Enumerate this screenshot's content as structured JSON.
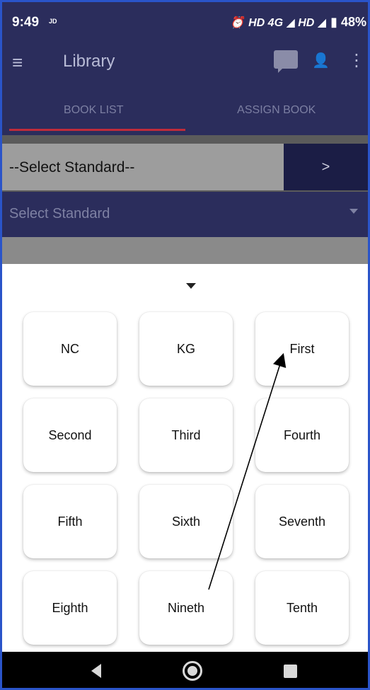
{
  "status_bar": {
    "time": "9:49",
    "carrier_tag": "JD",
    "network": "HD 4G ◢ HD ◢",
    "battery": "▮ 48%"
  },
  "app_bar": {
    "title": "Library",
    "menu_icon": "≡",
    "more_icon": "⋮"
  },
  "tabs": [
    {
      "label": "BOOK LIST",
      "active": true
    },
    {
      "label": "ASSIGN BOOK",
      "active": false
    }
  ],
  "select_bar": {
    "label": "--Select Standard--",
    "go_label": ">"
  },
  "standard_dropdown": {
    "placeholder": "Select Standard"
  },
  "standards": [
    {
      "label": "NC"
    },
    {
      "label": "KG"
    },
    {
      "label": "First"
    },
    {
      "label": "Second"
    },
    {
      "label": "Third"
    },
    {
      "label": "Fourth"
    },
    {
      "label": "Fifth"
    },
    {
      "label": "Sixth"
    },
    {
      "label": "Seventh"
    },
    {
      "label": "Eighth"
    },
    {
      "label": "Nineth"
    },
    {
      "label": "Tenth"
    }
  ],
  "colors": {
    "primary": "#2b2d5c",
    "tab_indicator": "#c02b3a"
  }
}
